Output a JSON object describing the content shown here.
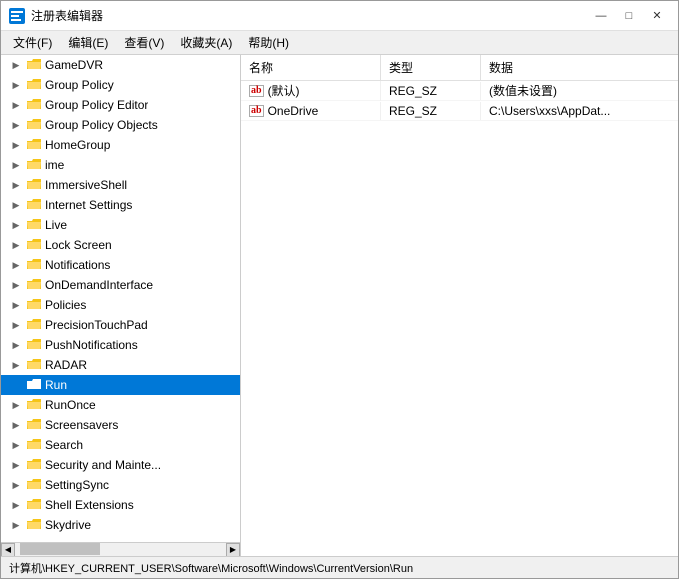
{
  "window": {
    "title": "注册表编辑器",
    "icon": "registry-icon"
  },
  "title_buttons": {
    "minimize": "—",
    "maximize": "□",
    "close": "✕"
  },
  "menu": {
    "items": [
      {
        "label": "文件(F)"
      },
      {
        "label": "编辑(E)"
      },
      {
        "label": "查看(V)"
      },
      {
        "label": "收藏夹(A)"
      },
      {
        "label": "帮助(H)"
      }
    ]
  },
  "tree_items": [
    {
      "id": "gameDVR",
      "label": "GameDVR",
      "selected": false,
      "expandable": true
    },
    {
      "id": "groupPolicy",
      "label": "Group Policy",
      "selected": false,
      "expandable": true
    },
    {
      "id": "groupPolicyEditor",
      "label": "Group Policy Editor",
      "selected": false,
      "expandable": true
    },
    {
      "id": "groupPolicyObjects",
      "label": "Group Policy Objects",
      "selected": false,
      "expandable": true
    },
    {
      "id": "homeGroup",
      "label": "HomeGroup",
      "selected": false,
      "expandable": true
    },
    {
      "id": "ime",
      "label": "ime",
      "selected": false,
      "expandable": true
    },
    {
      "id": "immersiveShell",
      "label": "ImmersiveShell",
      "selected": false,
      "expandable": true
    },
    {
      "id": "internetSettings",
      "label": "Internet Settings",
      "selected": false,
      "expandable": true
    },
    {
      "id": "live",
      "label": "Live",
      "selected": false,
      "expandable": true
    },
    {
      "id": "lockScreen",
      "label": "Lock Screen",
      "selected": false,
      "expandable": true
    },
    {
      "id": "notifications",
      "label": "Notifications",
      "selected": false,
      "expandable": true
    },
    {
      "id": "onDemandInterface",
      "label": "OnDemandInterface",
      "selected": false,
      "expandable": true
    },
    {
      "id": "policies",
      "label": "Policies",
      "selected": false,
      "expandable": true
    },
    {
      "id": "precisionTouchPad",
      "label": "PrecisionTouchPad",
      "selected": false,
      "expandable": true
    },
    {
      "id": "pushNotifications",
      "label": "PushNotifications",
      "selected": false,
      "expandable": true
    },
    {
      "id": "radar",
      "label": "RADAR",
      "selected": false,
      "expandable": true
    },
    {
      "id": "run",
      "label": "Run",
      "selected": true,
      "expandable": false
    },
    {
      "id": "runOnce",
      "label": "RunOnce",
      "selected": false,
      "expandable": true
    },
    {
      "id": "screensavers",
      "label": "Screensavers",
      "selected": false,
      "expandable": true
    },
    {
      "id": "search",
      "label": "Search",
      "selected": false,
      "expandable": true
    },
    {
      "id": "securityAndMaint",
      "label": "Security and Mainte...",
      "selected": false,
      "expandable": true
    },
    {
      "id": "settingSync",
      "label": "SettingSync",
      "selected": false,
      "expandable": true
    },
    {
      "id": "shellExtensions",
      "label": "Shell Extensions",
      "selected": false,
      "expandable": true
    },
    {
      "id": "skydrive",
      "label": "Skydrive",
      "selected": false,
      "expandable": true
    }
  ],
  "right_panel": {
    "headers": {
      "name": "名称",
      "type": "类型",
      "data": "数据"
    },
    "rows": [
      {
        "name": "(默认)",
        "icon": "ab",
        "type": "REG_SZ",
        "data": "(数值未设置)"
      },
      {
        "name": "OneDrive",
        "icon": "ab",
        "type": "REG_SZ",
        "data": "C:\\Users\\xxs\\AppDat..."
      }
    ]
  },
  "status_bar": {
    "path": "计算机\\HKEY_CURRENT_USER\\Software\\Microsoft\\Windows\\CurrentVersion\\Run"
  }
}
